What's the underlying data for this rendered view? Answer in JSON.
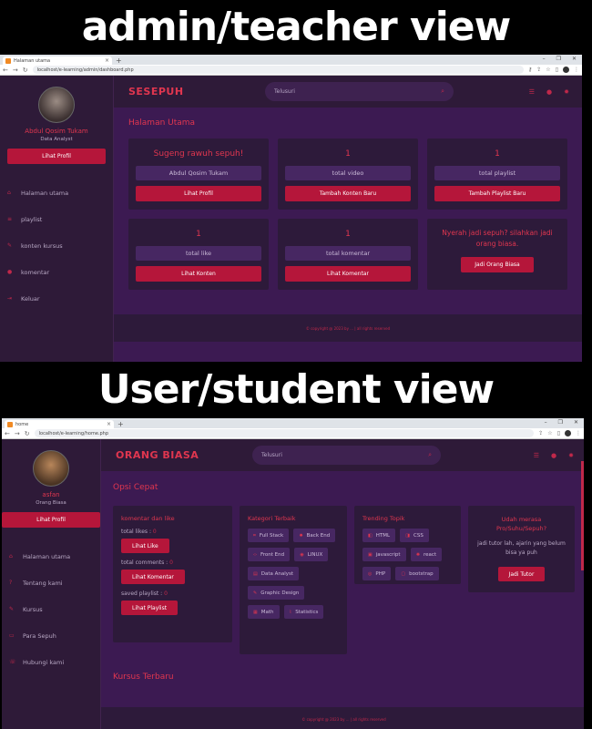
{
  "banner_top": "admin/teacher view",
  "banner_bottom": "User/student view",
  "admin": {
    "tab_title": "Halaman utama",
    "url": "localhost/e-learning/admin/dashboard.php",
    "user_name": "Abdul Qosim Tukam",
    "user_role": "Data Analyst",
    "profile_btn": "Lihat Profil",
    "menu": [
      "Halaman utama",
      "playlist",
      "konten kursus",
      "komentar",
      "Keluar"
    ],
    "logo": "SESEPUH",
    "search_placeholder": "Telusuri",
    "page_title": "Halaman Utama",
    "cards": [
      {
        "big": "Sugeng rawuh sepuh!",
        "pill": "Abdul Qosim Tukam",
        "btn": "Lihat Profil"
      },
      {
        "big": "1",
        "pill": "total video",
        "btn": "Tambah Konten Baru"
      },
      {
        "big": "1",
        "pill": "total playlist",
        "btn": "Tambah Playlist Baru"
      },
      {
        "big": "1",
        "pill": "total like",
        "btn": "Lihat Konten"
      },
      {
        "big": "1",
        "pill": "total komentar",
        "btn": "Lihat Komentar"
      },
      {
        "msg": "Nyerah jadi sepuh? silahkan jadi orang biasa.",
        "btn": "Jadi Orang Biasa"
      }
    ],
    "footer": "© copyright @ 2023 by ... | all rights reserved"
  },
  "student": {
    "tab_title": "home",
    "url": "localhost/e-learning/home.php",
    "user_name": "asfan",
    "user_role": "Orang Biasa",
    "profile_btn": "Lihat Profil",
    "menu": [
      "Halaman utama",
      "Tentang kami",
      "Kursus",
      "Para Sepuh",
      "Hubungi kami"
    ],
    "logo": "ORANG BIASA",
    "search_placeholder": "Telusuri",
    "section_title": "Opsi Cepat",
    "quick": {
      "title": "komentar dan like",
      "likes_label": "total likes :",
      "likes_val": "0",
      "likes_btn": "Lihat Like",
      "comments_label": "total comments :",
      "comments_val": "0",
      "comments_btn": "Lihat Komentar",
      "playlist_label": "saved playlist :",
      "playlist_val": "0",
      "playlist_btn": "Lihat Playlist"
    },
    "kategori_title": "Kategori Terbaik",
    "kategori": [
      "Full Stack",
      "Back End",
      "Front End",
      "LINUX",
      "Data Analyst",
      "Graphic Design",
      "Math",
      "Statistics"
    ],
    "topik_title": "Trending Topik",
    "topik": [
      "HTML",
      "CSS",
      "javascript",
      "react",
      "PHP",
      "bootstrap"
    ],
    "tutor_title": "Udah merasa Pro/Suhu/Sepuh?",
    "tutor_text": "jadi tutor lah, ajarin yang belum bisa ya puh",
    "tutor_btn": "Jadi Tutor",
    "kursus_title": "Kursus Terbaru",
    "footer": "© copyright @ 2023 by ... | all rights reserved"
  }
}
